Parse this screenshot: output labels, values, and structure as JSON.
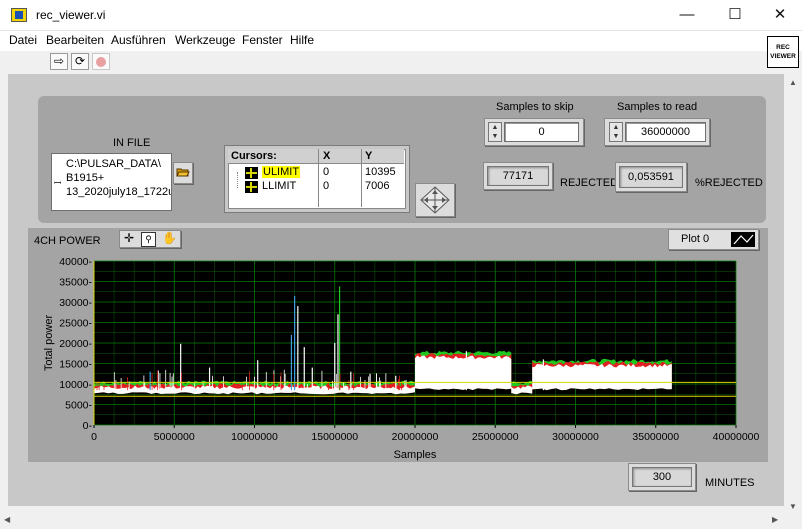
{
  "window": {
    "title": "rec_viewer.vi",
    "controls": {
      "minimize": "—",
      "maximize": "☐",
      "close": "✕"
    }
  },
  "menu": [
    "Datei",
    "Bearbeiten",
    "Ausführen",
    "Werkzeuge",
    "Fenster",
    "Hilfe"
  ],
  "toolbar": {
    "run_icon": "run-arrow-icon",
    "run_continuous_icon": "run-continuously-icon",
    "abort_icon": "abort-icon"
  },
  "vi_icon": {
    "line1": "REC",
    "line2": "VIEWER"
  },
  "in_file": {
    "label": "IN FILE",
    "path_lines": [
      "C:\\PULSAR_DATA\\",
      "B1915+",
      "13_2020july18_1722u"
    ],
    "browse_icon": "folder-icon"
  },
  "cursors": {
    "header": [
      "Cursors:",
      "X",
      "Y"
    ],
    "rows": [
      {
        "name": "ULIMIT",
        "x": "0",
        "y": "10395",
        "highlight": "#ffff00"
      },
      {
        "name": "LLIMIT",
        "x": "0",
        "y": "7006"
      }
    ]
  },
  "samples_to_skip": {
    "label": "Samples to skip",
    "value": "0"
  },
  "samples_to_read": {
    "label": "Samples to read",
    "value": "36000000"
  },
  "rejected": {
    "value": "77171",
    "label": "REJECTED"
  },
  "pct_rejected": {
    "value": "0,053591",
    "label": "%REJECTED"
  },
  "minutes": {
    "value": "300",
    "label": "MINUTES"
  },
  "chart_title": "4CH POWER",
  "plot_legend": {
    "label": "Plot 0"
  },
  "chart_data": {
    "type": "line",
    "xlabel": "Samples",
    "ylabel": "Total power",
    "xlim": [
      0,
      40000000
    ],
    "ylim": [
      0,
      40000
    ],
    "x_ticks": [
      "0",
      "5000000",
      "10000000",
      "15000000",
      "20000000",
      "25000000",
      "30000000",
      "35000000",
      "40000000"
    ],
    "y_ticks": [
      "0-",
      "5000-",
      "10000-",
      "15000-",
      "20000-",
      "25000-",
      "30000-",
      "35000-",
      "40000-"
    ],
    "grid": true,
    "background": "#000000",
    "grid_color": "#0a7a0a",
    "cursor_lines": [
      {
        "name": "ULIMIT",
        "y": 10395,
        "color": "#d8d800"
      },
      {
        "name": "LLIMIT",
        "y": 7006,
        "color": "#d8d800"
      }
    ],
    "series": [
      {
        "color": "#ffffff",
        "segments": [
          {
            "x0": 0,
            "x1": 20000000,
            "base": 8000,
            "top": 9200
          },
          {
            "x0": 20000000,
            "x1": 26000000,
            "base": 9000,
            "top": 16500
          },
          {
            "x0": 26000000,
            "x1": 27300000,
            "base": 8000,
            "top": 9200
          },
          {
            "x0": 27300000,
            "x1": 36000000,
            "base": 9000,
            "top": 14500
          }
        ]
      },
      {
        "color": "#1fc81f",
        "envelope_offset": 1200
      },
      {
        "color": "#e02020",
        "envelope_offset": 600
      }
    ],
    "spikes": [
      {
        "x": 5400000,
        "y": 19800,
        "color": "#ffffff"
      },
      {
        "x": 3500000,
        "y": 13000,
        "color": "#40a0e0"
      },
      {
        "x": 7200000,
        "y": 14000,
        "color": "#ffffff"
      },
      {
        "x": 10200000,
        "y": 15800,
        "color": "#ffffff"
      },
      {
        "x": 12500000,
        "y": 31500,
        "color": "#40a0e0"
      },
      {
        "x": 12700000,
        "y": 29000,
        "color": "#ffffff"
      },
      {
        "x": 12300000,
        "y": 22000,
        "color": "#40a0e0"
      },
      {
        "x": 13100000,
        "y": 19000,
        "color": "#ffffff"
      },
      {
        "x": 13600000,
        "y": 14000,
        "color": "#ffffff"
      },
      {
        "x": 15300000,
        "y": 33800,
        "color": "#1fc81f"
      },
      {
        "x": 15200000,
        "y": 27000,
        "color": "#ffffff"
      },
      {
        "x": 15000000,
        "y": 20000,
        "color": "#ffffff"
      },
      {
        "x": 16000000,
        "y": 13000,
        "color": "#ffffff"
      },
      {
        "x": 17200000,
        "y": 12500,
        "color": "#ffffff"
      },
      {
        "x": 18800000,
        "y": 12000,
        "color": "#ffffff"
      },
      {
        "x": 23200000,
        "y": 18000,
        "color": "#ffffff"
      },
      {
        "x": 28000000,
        "y": 16000,
        "color": "#ffffff"
      }
    ]
  }
}
